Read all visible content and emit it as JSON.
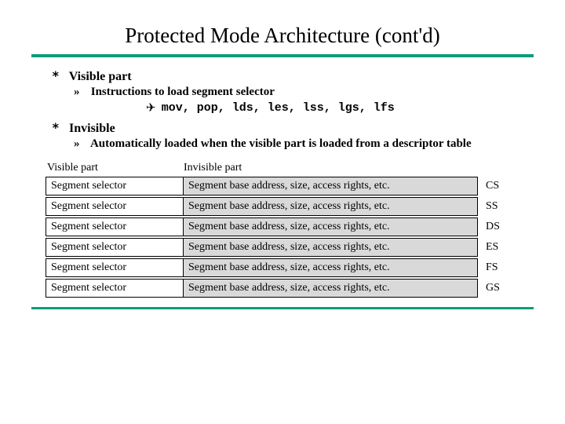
{
  "title": "Protected Mode Architecture (cont'd)",
  "bullets": {
    "b1a": "Visible part",
    "b2a": "Instructions to load segment selector",
    "b3a_code": "mov, pop, lds, les, lss, lgs, lfs",
    "b1b": "Invisible",
    "b2b": "Automatically loaded when the visible part is loaded from a descriptor table"
  },
  "markers": {
    "level1": "*",
    "level2": "»",
    "level3": "✈"
  },
  "figure": {
    "header_visible": "Visible part",
    "header_invisible": "Invisible part",
    "visible_text": "Segment selector",
    "invisible_text": "Segment base address, size, access rights, etc.",
    "registers": [
      "CS",
      "SS",
      "DS",
      "ES",
      "FS",
      "GS"
    ]
  }
}
